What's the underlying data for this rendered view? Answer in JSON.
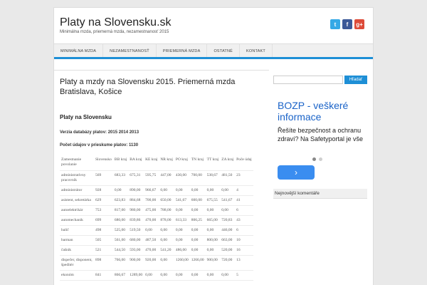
{
  "site": {
    "title": "Platy na Slovensku.sk",
    "tagline": "Minimálna mzda, priemerná mzda, nezamestnanosť 2015"
  },
  "social": [
    {
      "name": "twitter-icon",
      "glyph": "t",
      "color": "#35a9e6"
    },
    {
      "name": "facebook-icon",
      "glyph": "f",
      "color": "#3b5998"
    },
    {
      "name": "google-plus-icon",
      "glyph": "g+",
      "color": "#dd4b39"
    }
  ],
  "nav": [
    "MINIMÁLNA MZDA",
    "NEZAMESTNANOSŤ",
    "PRIEMERNÁ MZDA",
    "OSTATNÉ",
    "KONTAKT"
  ],
  "accent": "#1e8fd6",
  "article": {
    "headline": "Platy a mzdy na Slovensku 2015. Priemerná mzda Bratislava, Košice",
    "subheading": "Platy na Slovensku",
    "db_version": "Verzia databázy platov: 2015 2014 2013",
    "count": "Počet údajov v prieskume platov: 1130"
  },
  "table": {
    "headers": [
      "Zamestnanie povolanie",
      "Slovensko",
      "BB kraj",
      "BA kraj",
      "KE kraj",
      "NR kraj",
      "PO kraj",
      "TN kraj",
      "TT kraj",
      "ZA kraj",
      "Poče údaj"
    ],
    "rows": [
      [
        "administratívny pracovník",
        "569",
        "683,33",
        "675,31",
        "595,75",
        "447,00",
        "430,00",
        "700,00",
        "538,67",
        "481,50",
        "23"
      ],
      [
        "administrátor",
        "928",
        "0,00",
        "890,00",
        "966,67",
        "0,00",
        "0,00",
        "0,00",
        "0,00",
        "0,00",
        "4"
      ],
      [
        "asistent, sekretárka",
        "629",
        "623,83",
        "884,68",
        "700,00",
        "650,00",
        "541,67",
        "600,00",
        "675,55",
        "541,67",
        "41"
      ],
      [
        "autoelektrikár",
        "753",
        "817,00",
        "980,00",
        "475,00",
        "788,00",
        "0,00",
        "0,00",
        "0,00",
        "0,00",
        "6"
      ],
      [
        "automechanik",
        "699",
        "680,00",
        "839,86",
        "470,00",
        "878,00",
        "613,33",
        "806,25",
        "665,00",
        "720,83",
        "43"
      ],
      [
        "balič",
        "498",
        "525,00",
        "519,50",
        "0,00",
        "0,00",
        "0,00",
        "0,00",
        "0,00",
        "446,00",
        "6"
      ],
      [
        "barman",
        "505",
        "561,00",
        "680,00",
        "487,50",
        "0,00",
        "0,00",
        "0,00",
        "800,00",
        "663,00",
        "10"
      ],
      [
        "čašník",
        "521",
        "544,50",
        "593,00",
        "470,00",
        "541,20",
        "486,00",
        "0,00",
        "0,00",
        "520,00",
        "16"
      ],
      [
        "dispečer, disponent, špeditér",
        "898",
        "766,00",
        "900,00",
        "920,00",
        "0,00",
        "1260,00",
        "1266,00",
        "900,00",
        "720,00",
        "13"
      ],
      [
        "ekonóm",
        "841",
        "866,67",
        "1289,00",
        "0,00",
        "0,00",
        "0,00",
        "0,00",
        "0,00",
        "0,00",
        "5"
      ]
    ]
  },
  "sidebar": {
    "search_button": "Hľadať",
    "ad": {
      "title": "BOZP - veškeré informace",
      "text": "Řešíte bezpečnost a ochranu zdraví? Na Safetyportal je vše",
      "cta": "›"
    },
    "widget_title": "Nejnovější komentáře"
  }
}
